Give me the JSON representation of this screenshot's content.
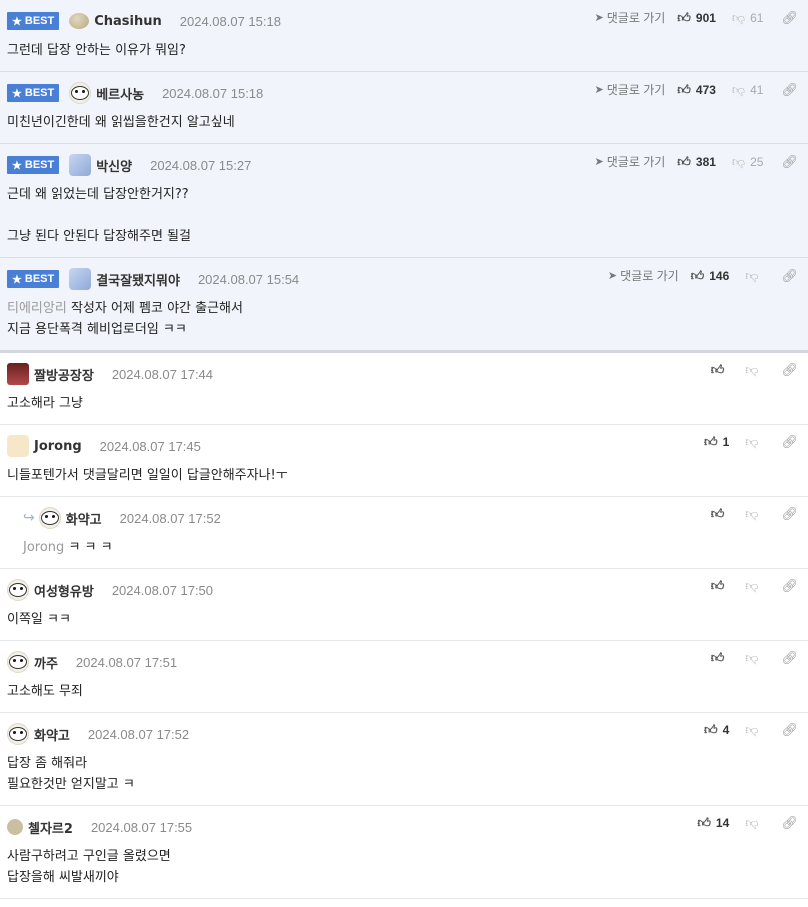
{
  "labels": {
    "best": "BEST",
    "goto_reply": "댓글로 가기"
  },
  "comments": [
    {
      "best": true,
      "avatar": "stone-avatar",
      "nick": "Chasihun",
      "date": "2024.08.07 15:18",
      "likes": "901",
      "dislikes": "61",
      "mention": "",
      "lines": [
        "그런데 답장 안하는 이유가 뭐임?"
      ]
    },
    {
      "best": true,
      "avatar": "dog-avatar",
      "nick": "베르사농",
      "date": "2024.08.07 15:18",
      "likes": "473",
      "dislikes": "41",
      "mention": "",
      "lines": [
        "미친년이긴한데 왜 읽씹을한건지 알고싶네"
      ]
    },
    {
      "best": true,
      "avatar": "sprite-avatar",
      "nick": "박신양",
      "date": "2024.08.07 15:27",
      "likes": "381",
      "dislikes": "25",
      "mention": "",
      "lines": [
        "근데 왜 읽었는데 답장안한거지??",
        "",
        "그냥 된다 안된다 답장해주면 될걸"
      ]
    },
    {
      "best": true,
      "avatar": "sprite-avatar",
      "nick": "결국잘됐지뭐야",
      "date": "2024.08.07 15:54",
      "likes": "146",
      "dislikes": "",
      "mention": "티에리앙리",
      "lines": [
        "작성자 어제 펨코 야간 출근해서",
        "지금 용단폭격 헤비업로더임 ㅋㅋ"
      ]
    },
    {
      "best": false,
      "avatar": "dark-avatar",
      "nick": "짤방공장장",
      "date": "2024.08.07 17:44",
      "likes": "",
      "dislikes": "",
      "mention": "",
      "lines": [
        "고소해라 그냥"
      ]
    },
    {
      "best": false,
      "avatar": "fox-avatar",
      "nick": "Jorong",
      "date": "2024.08.07 17:45",
      "likes": "1",
      "dislikes": "",
      "mention": "",
      "lines": [
        "니들포텐가서 댓글달리면 일일이 답글안해주자나!ㅜ"
      ]
    },
    {
      "best": false,
      "reply": true,
      "avatar": "dog-avatar",
      "nick": "화약고",
      "date": "2024.08.07 17:52",
      "likes": "",
      "dislikes": "",
      "mention": "Jorong",
      "lines": [
        "ㅋ ㅋ ㅋ"
      ]
    },
    {
      "best": false,
      "avatar": "dog-avatar",
      "nick": "여성형유방",
      "date": "2024.08.07 17:50",
      "likes": "",
      "dislikes": "",
      "mention": "",
      "lines": [
        "이쪽일 ㅋㅋ"
      ]
    },
    {
      "best": false,
      "avatar": "dog-avatar",
      "nick": "까주",
      "date": "2024.08.07 17:51",
      "likes": "",
      "dislikes": "",
      "mention": "",
      "lines": [
        "고소해도 무죄"
      ]
    },
    {
      "best": false,
      "avatar": "dog-avatar",
      "nick": "화약고",
      "date": "2024.08.07 17:52",
      "likes": "4",
      "dislikes": "",
      "mention": "",
      "lines": [
        "답장 좀 해줘라",
        "필요한것만 얻지말고 ㅋ"
      ]
    },
    {
      "best": false,
      "avatar": "plain-avatar",
      "nick": "첼자르2",
      "date": "2024.08.07 17:55",
      "likes": "14",
      "dislikes": "",
      "mention": "",
      "lines": [
        "사람구하려고 구인글 올렸으면",
        "답장을해 씨발새끼야"
      ]
    }
  ]
}
